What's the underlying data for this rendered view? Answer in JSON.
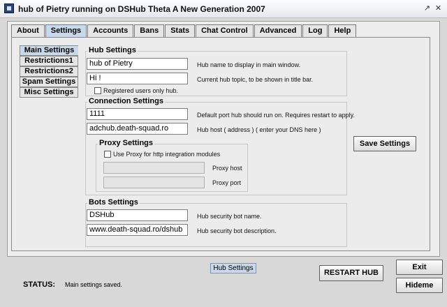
{
  "window": {
    "title": "hub of Pietry running on DSHub Theta A New Generation 2007"
  },
  "tabs": [
    "About",
    "Settings",
    "Accounts",
    "Bans",
    "Stats",
    "Chat Control",
    "Advanced",
    "Log",
    "Help"
  ],
  "active_tab": "Settings",
  "side_tabs": [
    "Main Settings",
    "Restrictions1",
    "Restrictions2",
    "Spam Settings",
    "Misc Settings"
  ],
  "active_side_tab": "Main Settings",
  "hub_settings": {
    "title": "Hub Settings",
    "hub_name": "hub of Pietry",
    "hub_name_hint": "Hub name to display in main window.",
    "topic": "Hi !",
    "topic_hint": "Current hub topic, to be shown in title bar.",
    "registered_only_label": "Registered users only hub."
  },
  "connection_settings": {
    "title": "Connection Settings",
    "port": "1111",
    "port_hint": "Default port hub should run on. Requires restart to apply.",
    "host": "adchub.death-squad.ro",
    "host_hint": "Hub host ( address ) ( enter your DNS here )"
  },
  "proxy_settings": {
    "title": "Proxy Settings",
    "use_proxy_label": "Use Proxy for http integration modules",
    "proxy_host_label": "Proxy host",
    "proxy_host": "",
    "proxy_port_label": "Proxy port",
    "proxy_port": ""
  },
  "bots_settings": {
    "title": "Bots Settings",
    "bot_name": "DSHub",
    "bot_name_hint": "Hub security bot name.",
    "bot_desc": "www.death-squad.ro/dshub",
    "bot_desc_hint": "Hub security bot description."
  },
  "buttons": {
    "save": "Save Settings",
    "restart": "RESTART HUB",
    "exit": "Exit",
    "hide": "Hideme"
  },
  "bottom_chip": "Hub Settings",
  "status": {
    "label": "STATUS:",
    "message": "Main settings saved."
  }
}
